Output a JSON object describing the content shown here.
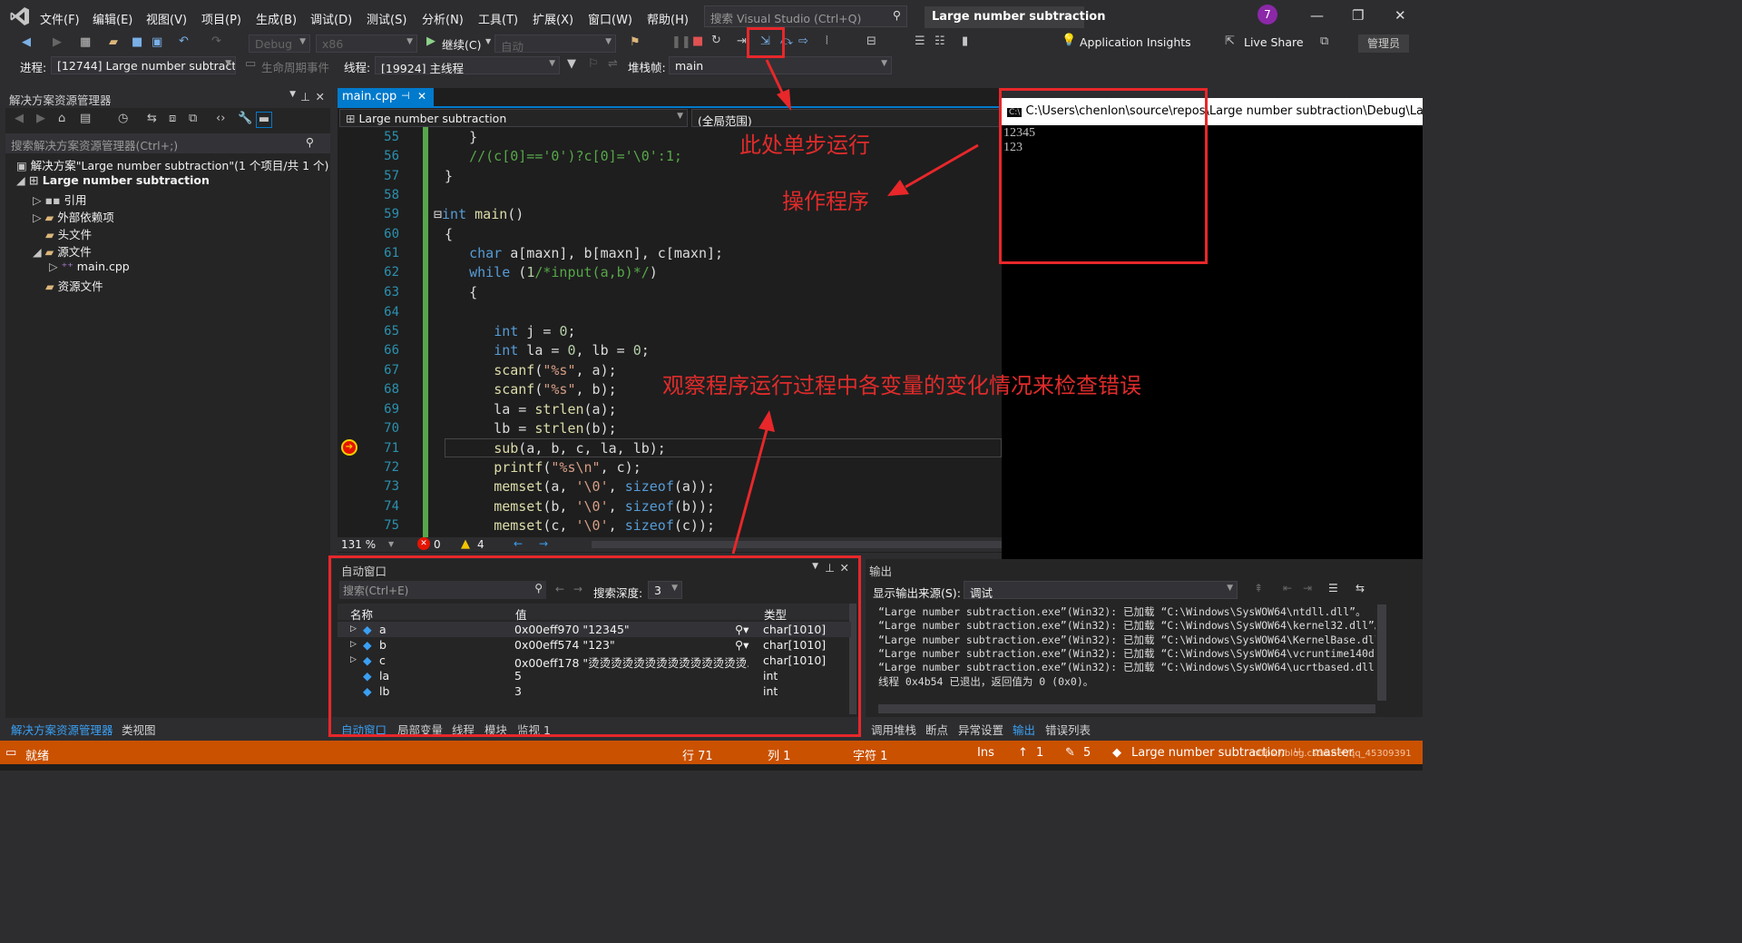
{
  "menubar": {
    "items": [
      "文件(F)",
      "编辑(E)",
      "视图(V)",
      "项目(P)",
      "生成(B)",
      "调试(D)",
      "测试(S)",
      "分析(N)",
      "工具(T)",
      "扩展(X)",
      "窗口(W)",
      "帮助(H)"
    ],
    "search_placeholder": "搜索 Visual Studio (Ctrl+Q)",
    "solution_title": "Large number subtraction",
    "avatar_count": "7"
  },
  "toolbar": {
    "config": "Debug",
    "platform": "x86",
    "continue_label": "继续(C)",
    "auto_label": "自动",
    "app_insights": "Application Insights",
    "live_share": "Live Share",
    "admin": "管理员"
  },
  "debugbar": {
    "process_label": "进程:",
    "process_value": "[12744] Large number subtract",
    "lifecycle_label": "生命周期事件",
    "thread_label": "线程:",
    "thread_value": "[19924] 主线程",
    "stackframe_label": "堆栈帧:",
    "stackframe_value": "main"
  },
  "solution_explorer": {
    "title": "解决方案资源管理器",
    "search_placeholder": "搜索解决方案资源管理器(Ctrl+;)",
    "solution_node": "解决方案\"Large number subtraction\"(1 个项目/共 1 个)",
    "project_node": "Large number subtraction",
    "nodes": [
      "引用",
      "外部依赖项",
      "头文件",
      "源文件",
      "main.cpp",
      "资源文件"
    ],
    "bottom_tabs": [
      "解决方案资源管理器",
      "类视图"
    ]
  },
  "editor": {
    "tab_name": "main.cpp",
    "scope_left": "Large number subtraction",
    "scope_right": "(全局范围)",
    "zoom": "131 %",
    "errors": "0",
    "warnings": "4",
    "line_numbers": [
      "55",
      "56",
      "57",
      "58",
      "59",
      "60",
      "61",
      "62",
      "63",
      "64",
      "65",
      "66",
      "67",
      "68",
      "69",
      "70",
      "71",
      "72",
      "73",
      "74",
      "75"
    ]
  },
  "console": {
    "title": "C:\\Users\\chenlon\\source\\repos\\Large number subtraction\\Debug\\Large n",
    "lines": [
      "12345",
      "123"
    ]
  },
  "annotations": {
    "step_run": "此处单步运行",
    "operate": "操作程序",
    "observe": "观察程序运行过程中各变量的变化情况来检查错误"
  },
  "autos": {
    "title": "自动窗口",
    "search_placeholder": "搜索(Ctrl+E)",
    "depth_label": "搜索深度:",
    "depth_value": "3",
    "headers": [
      "名称",
      "值",
      "类型"
    ],
    "rows": [
      {
        "name": "a",
        "value": "0x00eff970 \"12345\"",
        "type": "char[1010]"
      },
      {
        "name": "b",
        "value": "0x00eff574 \"123\"",
        "type": "char[1010]"
      },
      {
        "name": "c",
        "value": "0x00eff178 \"烫烫烫烫烫烫烫烫烫烫烫烫烫烫...",
        "type": "char[1010]"
      },
      {
        "name": "la",
        "value": "5",
        "type": "int"
      },
      {
        "name": "lb",
        "value": "3",
        "type": "int"
      }
    ],
    "bottom_tabs": [
      "自动窗口",
      "局部变量",
      "线程",
      "模块",
      "监视 1"
    ]
  },
  "output": {
    "title": "输出",
    "source_label": "显示输出来源(S):",
    "source_value": "调试",
    "lines": [
      "“Large number subtraction.exe”(Win32): 已加载 “C:\\Windows\\SysWOW64\\ntdll.dll”。",
      "“Large number subtraction.exe”(Win32): 已加载 “C:\\Windows\\SysWOW64\\kernel32.dll”。",
      "“Large number subtraction.exe”(Win32): 已加载 “C:\\Windows\\SysWOW64\\KernelBase.dll”",
      "“Large number subtraction.exe”(Win32): 已加载 “C:\\Windows\\SysWOW64\\vcruntime140d.d",
      "“Large number subtraction.exe”(Win32): 已加载 “C:\\Windows\\SysWOW64\\ucrtbased.dll”",
      "线程 0x4b54 已退出，返回值为 0 (0x0)。"
    ],
    "bottom_tabs": [
      "调用堆栈",
      "断点",
      "异常设置",
      "输出",
      "错误列表"
    ]
  },
  "statusbar": {
    "ready": "就绪",
    "line": "行 71",
    "col": "列 1",
    "char": "字符 1",
    "ins": "Ins",
    "up": "1",
    "pencil": "5",
    "project": "Large number subtraction",
    "branch": "master",
    "watermark": "https://blog.csdn.net/qq_45309391"
  },
  "colors": {
    "accent": "#007acc",
    "statusbar": "#ca5100",
    "annotation": "#e8272a"
  }
}
